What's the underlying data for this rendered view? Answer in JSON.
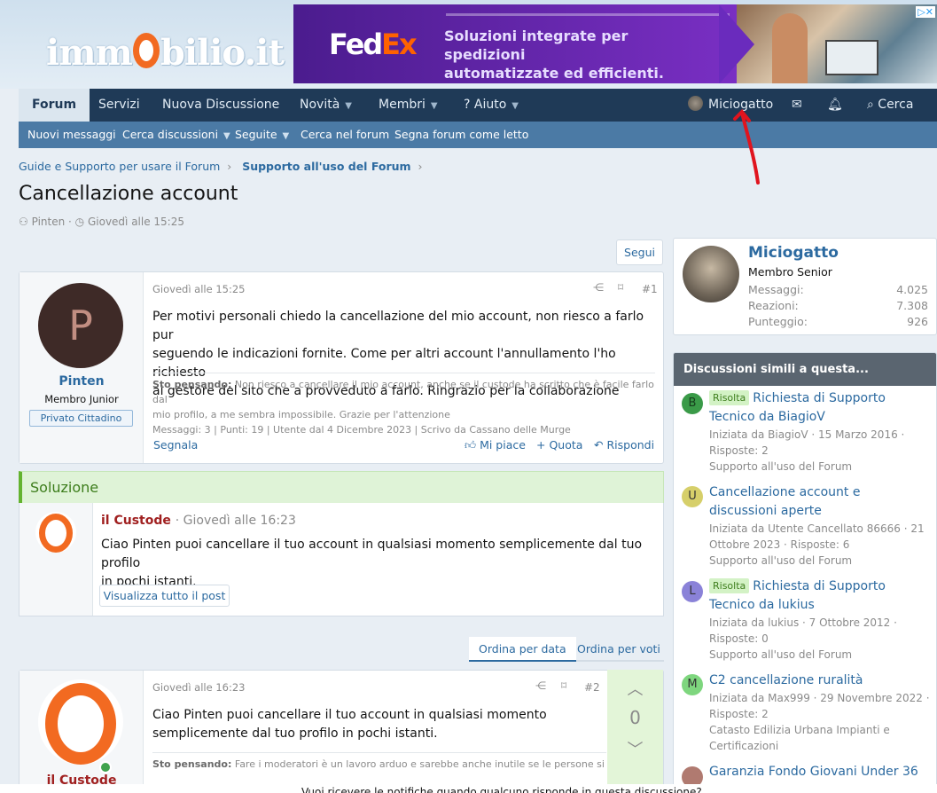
{
  "header": {
    "logo": "immobilio.it"
  },
  "ad": {
    "brand_a": "Fed",
    "brand_b": "Ex",
    "line1": "Soluzioni integrate per spedizioni",
    "line2": "automatizzate ed efficienti."
  },
  "nav": {
    "tabs": [
      {
        "label": "Forum",
        "active": true
      },
      {
        "label": "Servizi"
      },
      {
        "label": "Nuova Discussione"
      },
      {
        "label": "Novità"
      },
      {
        "label": "Membri"
      },
      {
        "label": "? Aiuto"
      }
    ],
    "user": "Miciogatto",
    "search": "Cerca"
  },
  "subnav": [
    "Nuovi messaggi",
    "Cerca discussioni",
    "Seguite",
    "Cerca nel forum",
    "Segna forum come letto"
  ],
  "breadcrumb": [
    "Guide e Supporto per usare il Forum",
    "Supporto all'uso del Forum"
  ],
  "thread": {
    "title": "Cancellazione account",
    "author": "Pinten",
    "date": "Giovedì alle 15:25",
    "follow": "Segui"
  },
  "post1": {
    "avatar_letter": "P",
    "user": "Pinten",
    "role": "Membro Junior",
    "badge": "Privato Cittadino",
    "date": "Giovedì alle 15:25",
    "num": "#1",
    "line1": "Per motivi personali chiedo la cancellazione del mio account, non riesco a farlo pur",
    "line2": "seguendo le indicazioni fornite. Come per altri account l'annullamento l'ho richiesto",
    "line3": "al gestore del sito che a provveduto a farlo. Ringrazio per la collaborazione",
    "sig_label": "Sto pensando:",
    "sig1": "Non riesco a cancellare il mio account, anche se il custode ha scritto che è facile farlo dal",
    "sig2": "mio profilo, a me sembra impossibile. Grazie per l'attenzione",
    "sig3": "Messaggi: 3 | Punti: 19 | Utente dal 4 Dicembre 2023 | Scrivo da Cassano delle Murge",
    "report": "Segnala",
    "like": "Mi piace",
    "quote": "+ Quota",
    "reply": "Rispondi"
  },
  "solution": {
    "header": "Soluzione",
    "user": "il Custode",
    "date": "· Giovedì alle 16:23",
    "line1": "Ciao Pinten puoi cancellare il tuo account in qualsiasi momento semplicemente dal tuo profilo",
    "line2": "in pochi istanti.",
    "button": "Visualizza tutto il post"
  },
  "sort": {
    "by_date": "Ordina per data",
    "by_votes": "Ordina per voti"
  },
  "post2": {
    "date": "Giovedì alle 16:23",
    "num": "#2",
    "line1": "Ciao Pinten puoi cancellare il tuo account in qualsiasi momento",
    "line2": "semplicemente dal tuo profilo in pochi istanti.",
    "sig_label": "Sto pensando:",
    "sig1": "Fare i moderatori è un lavoro arduo e sarebbe anche inutile se le persone si",
    "user_partial": "il Custode",
    "votes": "0"
  },
  "profile_card": {
    "name": "Miciogatto",
    "role": "Membro Senior",
    "stats": [
      {
        "label": "Messaggi:",
        "value": "4.025"
      },
      {
        "label": "Reazioni:",
        "value": "7.308"
      },
      {
        "label": "Punteggio:",
        "value": "926"
      }
    ]
  },
  "similar": {
    "header": "Discussioni simili a questa...",
    "items": [
      {
        "letter": "B",
        "color": "#3a9a48",
        "badge": "Risolta",
        "title": "Richiesta di Supporto Tecnico da BiagioV",
        "meta1": "Iniziata da BiagioV · 15 Marzo 2016 ·",
        "meta2": "Risposte: 2",
        "forum": "Supporto all'uso del Forum"
      },
      {
        "letter": "U",
        "color": "#d6cf6a",
        "badge": "",
        "title": "Cancellazione account e discussioni aperte",
        "meta1": "Iniziata da Utente Cancellato 86666 · 21",
        "meta2": "Ottobre 2023 · Risposte: 6",
        "forum": "Supporto all'uso del Forum"
      },
      {
        "letter": "L",
        "color": "#8a82d8",
        "badge": "Risolta",
        "title": "Richiesta di Supporto Tecnico da lukius",
        "meta1": "Iniziata da lukius · 7 Ottobre 2012 ·",
        "meta2": "Risposte: 0",
        "forum": "Supporto all'uso del Forum"
      },
      {
        "letter": "M",
        "color": "#7ed67e",
        "badge": "",
        "title": "C2 cancellazione ruralità",
        "meta1": "Iniziata da Max999 · 29 Novembre 2022 ·",
        "meta2": "Risposte: 2",
        "forum": "Catasto Edilizia Urbana Impianti e Certificazioni"
      },
      {
        "letter": "",
        "color": "#b07a70",
        "badge": "",
        "title": "Garanzia Fondo Giovani Under 36",
        "meta1": "",
        "meta2": "",
        "forum": ""
      }
    ]
  },
  "bottom_text": "Vuoi ricevere le notifiche quando qualcuno risponde in questa discussione?"
}
